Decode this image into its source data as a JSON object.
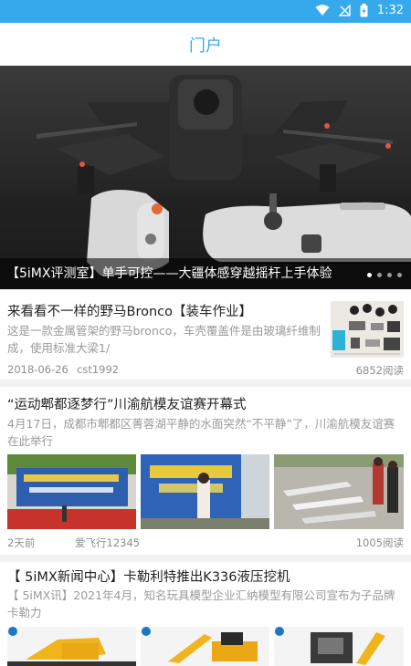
{
  "status_bar": {
    "time": "1:32",
    "icons": [
      "wifi-icon",
      "signal-off-icon",
      "battery-icon"
    ]
  },
  "app_bar": {
    "title": "门户"
  },
  "banner": {
    "caption": "【5iMX评测室】单手可控——大疆体感穿越摇杆上手体验",
    "page_count": 4,
    "active_index": 0
  },
  "articles": [
    {
      "title": "来看看不一样的野马Bronco【装车作业】",
      "summary": "这是一款金属管架的野马bronco，车壳覆盖件是由玻璃纤维制成，使用标准大梁1/",
      "date": "2018-06-26",
      "author": "cst1992",
      "reads": "6852阅读"
    },
    {
      "title": "“运动郫都逐梦行”川渝航模友谊赛开幕式",
      "summary": "4月17日，成都市郫都区菁蓉湖平静的水面突然“不平静”了，川渝航模友谊赛在此举行",
      "date": "2天前",
      "author": "爱飞行12345",
      "reads": "1005阅读"
    },
    {
      "title": "【 5iMX新闻中心】卡勒利特推出K336液压挖机",
      "summary": "【 5iMX讯】2021年4月，知名玩具模型企业汇纳模型有限公司宣布为子品牌卡勒力"
    }
  ]
}
